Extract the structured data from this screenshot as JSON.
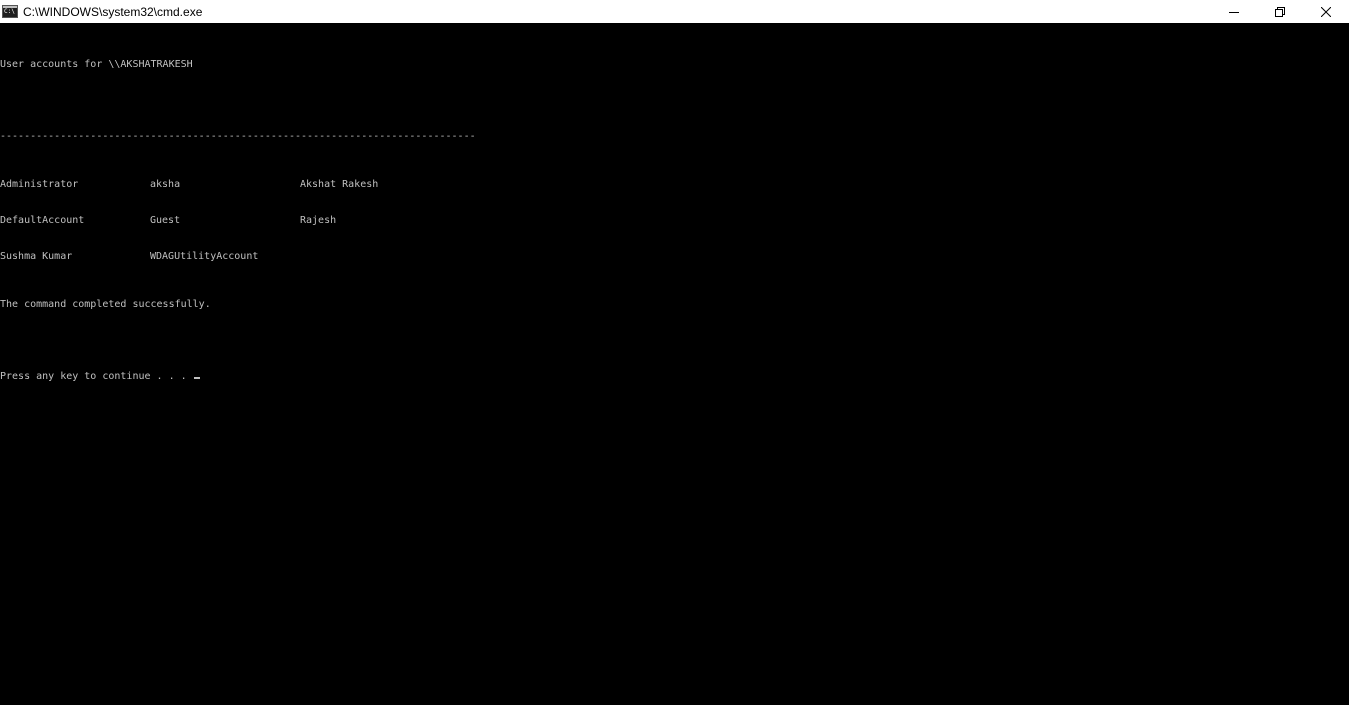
{
  "window": {
    "title": "C:\\WINDOWS\\system32\\cmd.exe",
    "icon": "cmd-icon",
    "controls": {
      "minimize_icon": "minimize-icon",
      "restore_icon": "restore-icon",
      "close_icon": "close-icon"
    }
  },
  "console": {
    "header": "User accounts for \\\\AKSHATRAKESH",
    "separator": "-------------------------------------------------------------------------------",
    "accounts": [
      [
        "Administrator",
        "aksha",
        "Akshat Rakesh"
      ],
      [
        "DefaultAccount",
        "Guest",
        "Rajesh"
      ],
      [
        "Sushma Kumar",
        "WDAGUtilityAccount",
        ""
      ]
    ],
    "status": "The command completed successfully.",
    "prompt": "Press any key to continue . . . "
  },
  "colors": {
    "background": "#000000",
    "text": "#c0c0c0",
    "titlebar": "#ffffff"
  }
}
